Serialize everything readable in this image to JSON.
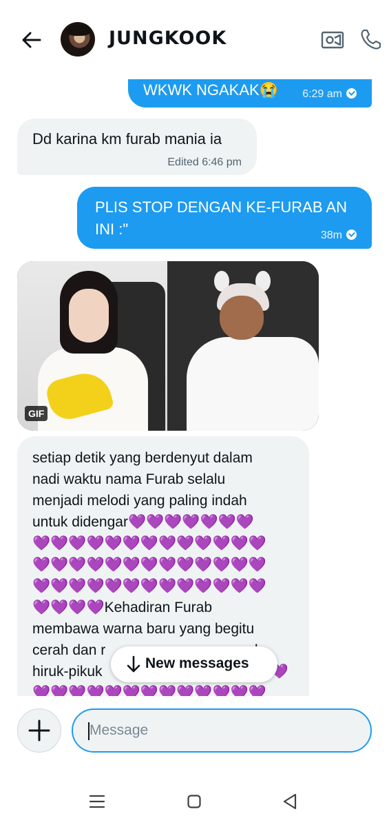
{
  "header": {
    "contact_name": "JUNGKOOK",
    "icons": [
      "back-arrow-icon",
      "avatar",
      "video-call-icon",
      "phone-call-icon"
    ]
  },
  "messages": [
    {
      "direction": "out",
      "text": "WKWK NGAKAK😭",
      "time": "6:29 am",
      "status": "seen"
    },
    {
      "direction": "in",
      "text": "Dd karina km furab mania ia",
      "time": "Edited 6:46 pm"
    },
    {
      "direction": "out",
      "lines": [
        "PLIS STOP DENGAN KE-FURAB AN",
        "INI :\""
      ],
      "time": "38m",
      "status": "seen"
    },
    {
      "direction": "in",
      "type": "gif",
      "badge": "GIF"
    },
    {
      "direction": "in",
      "lines": [
        "setiap detik yang berdenyut dalam",
        "nadi waktu nama Furab selalu",
        "menjadi melodi yang paling indah",
        "untuk didengar",
        "💜💜💜💜💜💜💜",
        "💜💜💜💜💜💜💜💜💜💜💜💜💜",
        "💜💜💜💜💜💜💜💜💜💜💜💜💜",
        "💜💜💜💜💜💜💜💜💜💜💜💜💜",
        "💜💜💜💜",
        "Kehadiran Furab",
        "membawa warna baru yang begitu",
        "cerah dan r",
        "ah",
        "hiruk-pikuk",
        "💜",
        "💜💜💜💜💜💜💜💜💜💜💜💜💜"
      ]
    }
  ],
  "new_messages_label": "New messages",
  "composer": {
    "placeholder": "Message"
  },
  "colors": {
    "accent": "#1d9bf0",
    "incoming": "#eff3f4",
    "heart": "#a855f7"
  }
}
